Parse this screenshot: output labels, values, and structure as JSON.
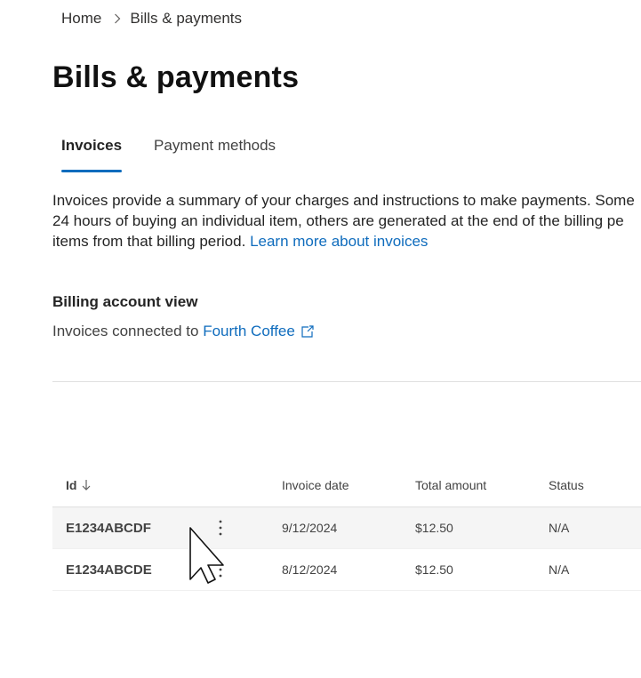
{
  "breadcrumb": {
    "home": "Home",
    "current": "Bills & payments"
  },
  "page": {
    "title": "Bills & payments"
  },
  "tabs": [
    {
      "label": "Invoices",
      "active": true
    },
    {
      "label": "Payment methods",
      "active": false
    }
  ],
  "description": {
    "line1": "Invoices provide a summary of your charges and instructions to make payments. Some",
    "line2": "24 hours of buying an individual item, others are generated at the end of the billing pe",
    "line3_text": "items from that billing period.",
    "link": "Learn more about invoices"
  },
  "billing": {
    "heading": "Billing account view",
    "prefix": "Invoices connected to",
    "account_link": "Fourth Coffee"
  },
  "table": {
    "columns": {
      "id": "Id",
      "invoice_date": "Invoice date",
      "total_amount": "Total amount",
      "status": "Status"
    },
    "rows": [
      {
        "id": "E1234ABCDF",
        "date": "9/12/2024",
        "total": "$12.50",
        "status": "N/A"
      },
      {
        "id": "E1234ABCDE",
        "date": "8/12/2024",
        "total": "$12.50",
        "status": "N/A"
      }
    ]
  },
  "colors": {
    "accent": "#0f6cbd",
    "text": "#242424",
    "row_hover": "#f5f5f5"
  }
}
